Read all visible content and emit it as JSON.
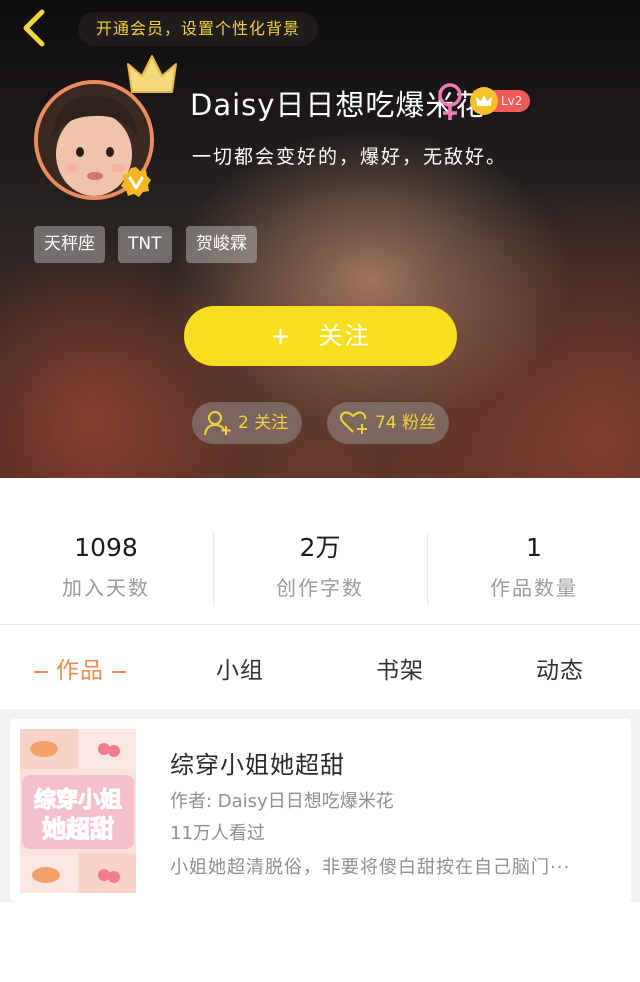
{
  "header": {
    "vip_banner": "开通会员，设置个性化背景",
    "username": "Daisy日日想吃爆米花",
    "level_badge": "Lv2",
    "bio": "一切都会变好的，爆好，无敌好。",
    "tags": [
      "天秤座",
      "TNT",
      "贺峻霖"
    ],
    "follow_button": {
      "icon": "+",
      "label": "关注"
    },
    "following": "2 关注",
    "fans": "74 粉丝",
    "colors": {
      "accent_yellow": "#f8de20",
      "pill_text": "#f3d33e",
      "avatar_border": "#f08a63",
      "gender_pink": "#f07ab3"
    }
  },
  "stats": [
    {
      "value": "1098",
      "label": "加入天数"
    },
    {
      "value": "2万",
      "label": "创作字数"
    },
    {
      "value": "1",
      "label": "作品数量"
    }
  ],
  "tabs": [
    "作品",
    "小组",
    "书架",
    "动态"
  ],
  "active_tab_color": "#f28a52",
  "work": {
    "title": "综穿小姐她超甜",
    "author": "作者: Daisy日日想吃爆米花",
    "views": "11万人看过",
    "description": "小姐她超清脱俗，非要将傻白甜按在自己脑门···",
    "cover_text": [
      "综穿小姐",
      "她超甜"
    ]
  }
}
